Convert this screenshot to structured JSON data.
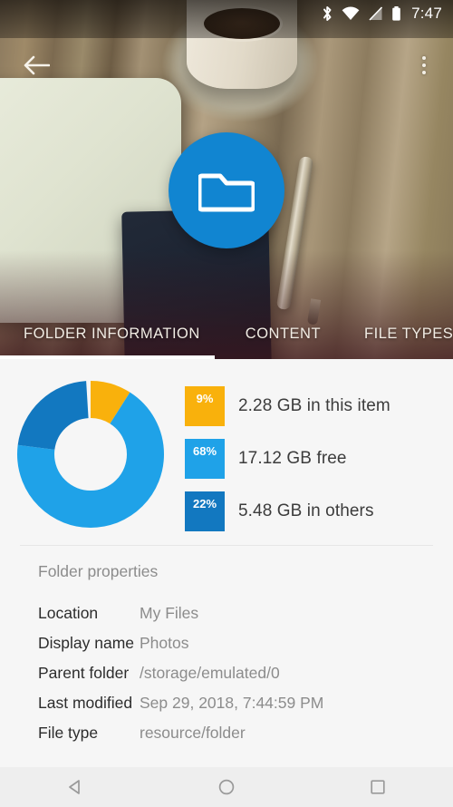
{
  "statusbar": {
    "time": "7:47",
    "icons": [
      "bluetooth-icon",
      "wifi-icon",
      "no-sim-signal-icon",
      "battery-icon"
    ]
  },
  "appbar": {
    "back_icon": "back-arrow-icon",
    "overflow_icon": "overflow-menu-icon",
    "badge_icon": "folder-icon"
  },
  "tabs": [
    {
      "label": "FOLDER INFORMATION",
      "selected": true
    },
    {
      "label": "CONTENT",
      "selected": false
    },
    {
      "label": "FILE TYPES",
      "selected": false
    }
  ],
  "chart_data": {
    "type": "pie",
    "title": "",
    "donut": true,
    "labels": [
      "in this item",
      "free",
      "in others"
    ],
    "values": [
      9,
      68,
      22
    ],
    "value_labels": [
      "9%",
      "68%",
      "22%"
    ],
    "sizes": [
      "2.28 GB",
      "17.12 GB",
      "5.48 GB"
    ],
    "legend_text": [
      "2.28 GB in this item",
      "17.12 GB free",
      "5.48 GB in others"
    ],
    "colors": [
      "#f9b10c",
      "#1fa2e8",
      "#1278c0"
    ],
    "legend_position": "right"
  },
  "legend": [
    {
      "percent": "9%",
      "text": "2.28 GB in this item",
      "color": "#f9b10c"
    },
    {
      "percent": "68%",
      "text": "17.12 GB free",
      "color": "#1fa2e8"
    },
    {
      "percent": "22%",
      "text": "5.48 GB in others",
      "color": "#1278c0"
    }
  ],
  "properties": {
    "section_title": "Folder properties",
    "rows": [
      {
        "label": "Location",
        "value": "My Files"
      },
      {
        "label": "Display name",
        "value": "Photos"
      },
      {
        "label": "Parent folder",
        "value": "/storage/emulated/0"
      },
      {
        "label": "Last modified",
        "value": "Sep 29, 2018, 7:44:59 PM"
      },
      {
        "label": "File type",
        "value": "resource/folder"
      }
    ]
  },
  "navbar": {
    "back": "nav-back-icon",
    "home": "nav-home-icon",
    "recents": "nav-recents-icon"
  },
  "colors": {
    "accent": "#1185d1",
    "content_bg": "#f6f6f6",
    "navbar_bg": "#eeeeee"
  }
}
